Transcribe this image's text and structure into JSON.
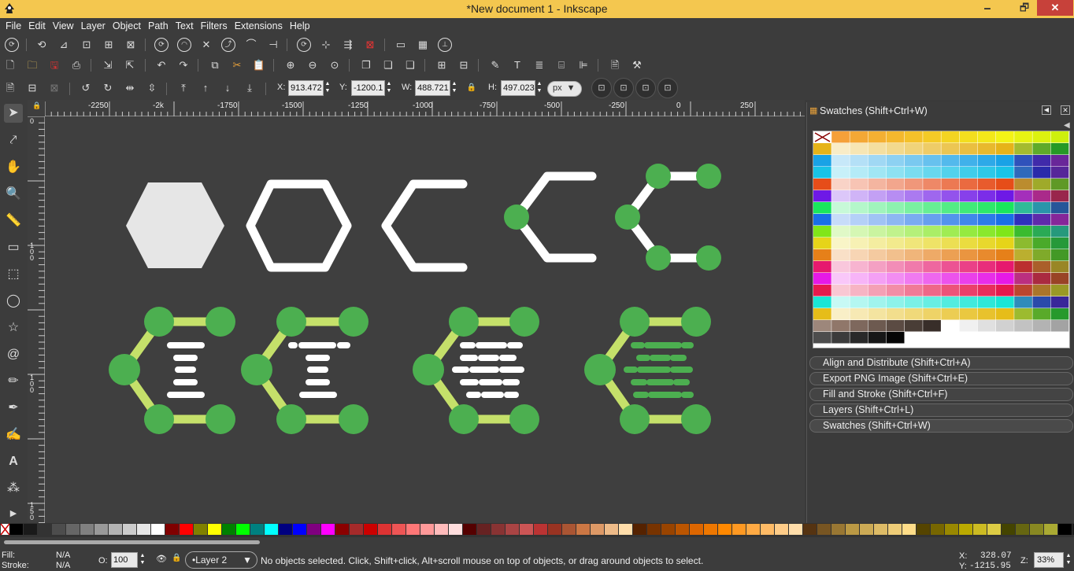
{
  "window": {
    "title": "*New document 1 - Inkscape",
    "minimize": "🗕",
    "restore": "🗗",
    "close": "✕"
  },
  "menu": [
    "File",
    "Edit",
    "View",
    "Layer",
    "Object",
    "Path",
    "Text",
    "Filters",
    "Extensions",
    "Help"
  ],
  "select_toolbar": {
    "x_label": "X:",
    "x": "913.472",
    "y_label": "Y:",
    "y": "-1200.1",
    "w_label": "W:",
    "w": "488.721",
    "h_label": "H:",
    "h": "497.023",
    "unit": "px"
  },
  "ruler": {
    "h_ticks": [
      "-2250",
      "-2k",
      "-1750",
      "-1500",
      "-1250",
      "-1000",
      "-750",
      "-500",
      "-250",
      "0",
      "250"
    ],
    "v_ticks": [
      "0",
      "100",
      "100",
      "150"
    ]
  },
  "colors": {
    "canvas": "#3f3f3f",
    "green": "#4caf50",
    "lime": "#c5e06a",
    "white": "#ffffff",
    "hex_fill": "#e6e6e6"
  },
  "swatches_panel": {
    "title": "Swatches (Shift+Ctrl+W)"
  },
  "dock_tabs": [
    "Align and Distribute (Shift+Ctrl+A)",
    "Export PNG Image (Shift+Ctrl+E)",
    "Fill and Stroke (Shift+Ctrl+F)",
    "Layers (Shift+Ctrl+L)",
    "Swatches (Shift+Ctrl+W)"
  ],
  "status": {
    "fill_label": "Fill:",
    "fill_value": "N/A",
    "stroke_label": "Stroke:",
    "stroke_value": "N/A",
    "opacity_label": "O:",
    "opacity": "100",
    "layer": "•Layer 2",
    "message": "No objects selected. Click, Shift+click, Alt+scroll mouse on top of objects, or drag around objects to select.",
    "x_label": "X:",
    "x": "328.07",
    "y_label": "Y:",
    "y": "-1215.95",
    "zoom_label": "Z:",
    "zoom": "33%"
  }
}
